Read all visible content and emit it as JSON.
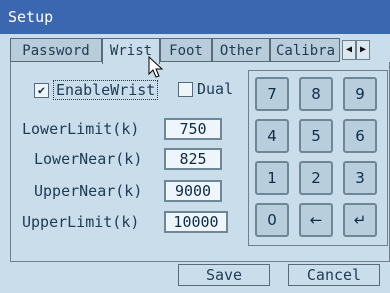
{
  "title": "Setup",
  "tabs": [
    "Password",
    "Wrist",
    "Foot",
    "Other",
    "Calibra"
  ],
  "active_tab": "Wrist",
  "checkboxes": [
    {
      "label": "EnableWrist",
      "checked": true
    },
    {
      "label": "Dual",
      "checked": false
    }
  ],
  "fields": [
    {
      "label": "LowerLimit(k)",
      "value": "750"
    },
    {
      "label": "LowerNear(k)",
      "value": "825"
    },
    {
      "label": "UpperNear(k)",
      "value": "9000"
    },
    {
      "label": "UpperLimit(k)",
      "value": "10000"
    }
  ],
  "keypad": [
    "7",
    "8",
    "9",
    "4",
    "5",
    "6",
    "1",
    "2",
    "3",
    "0",
    "←",
    "↵"
  ],
  "buttons": {
    "save": "Save",
    "cancel": "Cancel"
  },
  "check_mark": "✔",
  "arrows": {
    "left": "◀",
    "right": "▶"
  }
}
